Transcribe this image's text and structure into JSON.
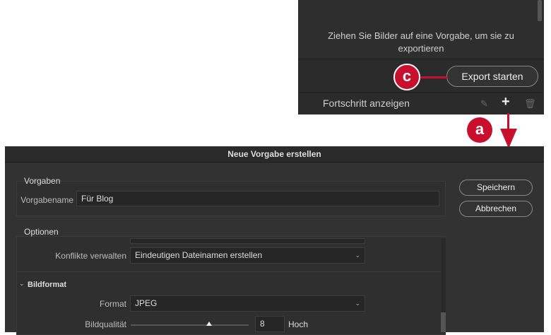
{
  "export_panel": {
    "drop_message": "Ziehen Sie Bilder auf eine Vorgabe, um sie zu exportieren",
    "export_button": "Export starten",
    "progress_label": "Fortschritt anzeigen"
  },
  "callouts": {
    "c": "c",
    "a": "a"
  },
  "dialog": {
    "title": "Neue Vorgabe erstellen",
    "vorgaben": {
      "title": "Vorgaben",
      "name_label": "Vorgabename",
      "name_value": "Für Blog"
    },
    "save_button": "Speichern",
    "cancel_button": "Abbrechen",
    "optionen": {
      "title": "Optionen",
      "conflicts_label": "Konflikte verwalten",
      "conflicts_value": "Eindeutigen Dateinamen erstellen",
      "section_bildformat": "Bildformat",
      "format_label": "Format",
      "format_value": "JPEG",
      "quality_label": "Bildqualität",
      "quality_value": "8",
      "quality_max": 12,
      "quality_text": "Hoch"
    }
  },
  "colors": {
    "accent": "#c8102e"
  }
}
